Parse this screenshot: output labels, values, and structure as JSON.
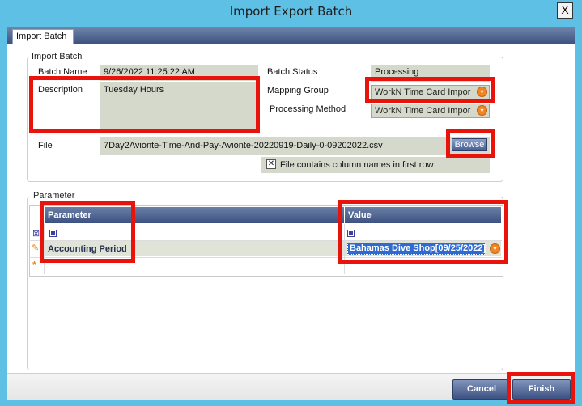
{
  "window": {
    "title": "Import Export Batch",
    "close_label": "X"
  },
  "tab": {
    "label": "Import Batch"
  },
  "import_batch": {
    "group_label": "Import Batch",
    "batch_name_label": "Batch Name",
    "batch_name_value": "9/26/2022 11:25:22 AM",
    "description_label": "Description",
    "description_value": "Tuesday Hours",
    "batch_status_label": "Batch Status",
    "batch_status_value": "Processing",
    "mapping_group_label": "Mapping Group",
    "mapping_group_value": "WorkN Time Card Impor",
    "processing_method_label": "Processing Method",
    "processing_method_value": "WorkN Time Card Impor",
    "file_label": "File",
    "file_value": "7Day2Avionte-Time-And-Pay-Avionte-20220919-Daily-0-09202022.csv",
    "browse_label": "Browse",
    "header_checkbox_label": "File contains column names in first row",
    "header_checkbox_checked": true
  },
  "parameter": {
    "group_label": "Parameter",
    "columns": [
      "Parameter",
      "Value"
    ],
    "rows": [
      {
        "parameter": "Accounting Period",
        "value": "Bahamas Dive Shop[09/25/2022]"
      }
    ]
  },
  "buttons": {
    "cancel": "Cancel",
    "finish": "Finish"
  },
  "icons": {
    "filter_row": "filter-icon",
    "edit_row": "pencil-icon",
    "new_row": "asterisk-icon",
    "dropdown": "orange-dropdown-icon"
  },
  "colors": {
    "accent_red": "#e8140c",
    "header_blue": "#3c5180",
    "field_gray": "#d5d9cc",
    "dropdown_orange": "#f08522"
  }
}
